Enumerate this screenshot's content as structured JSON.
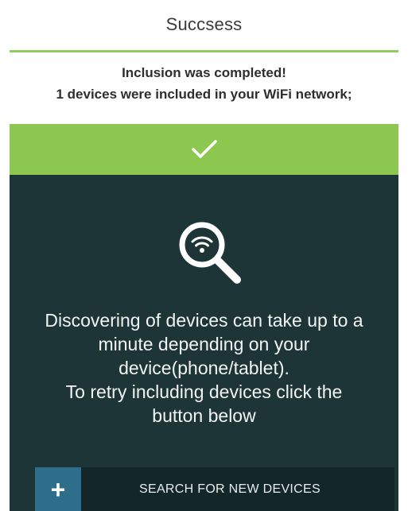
{
  "header": {
    "title": "Succsess"
  },
  "message": {
    "line1": "Inclusion was completed!",
    "line2": "1 devices were included in your WiFi network;"
  },
  "status": {
    "icon": "check-icon"
  },
  "info": {
    "icon": "wifi-search-icon",
    "lines": [
      "Discovering of devices can take up to a",
      "minute depending on your",
      "device(phone/tablet).",
      "To retry including devices click the",
      "button below"
    ]
  },
  "search_button": {
    "icon_label": "+",
    "label": "SEARCH FOR NEW DEVICES"
  },
  "colors": {
    "accent_green": "#8cc850",
    "panel_dark": "#1e3538",
    "button_blue": "#2d6e8a"
  }
}
